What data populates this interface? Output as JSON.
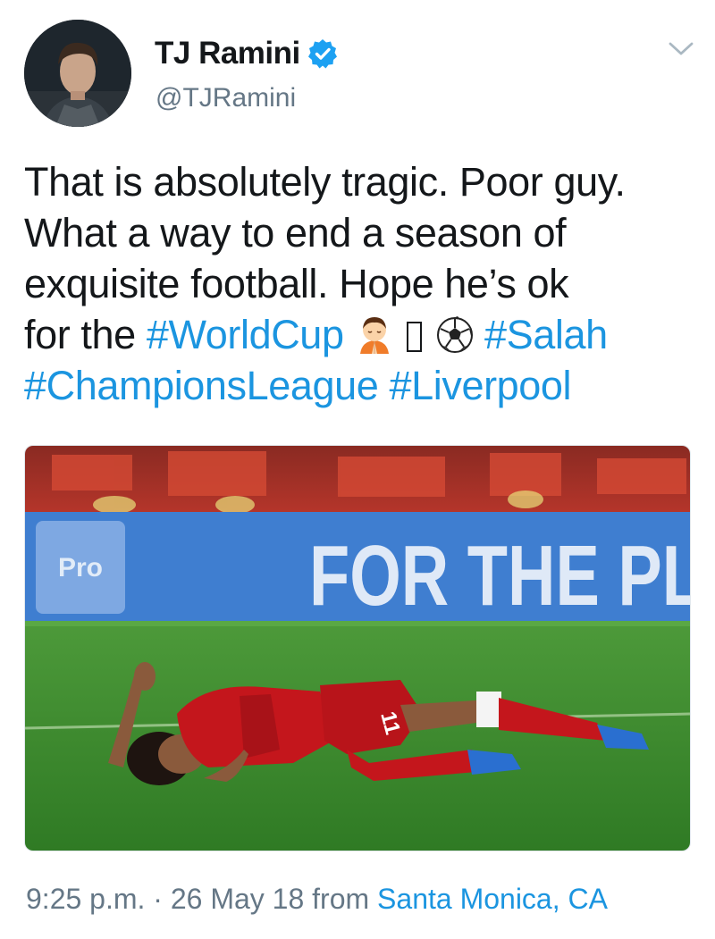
{
  "author": {
    "display_name": "TJ Ramini",
    "handle": "@TJRamini",
    "verified": true,
    "avatar_icon": "profile-avatar",
    "verified_icon": "verified-badge-icon"
  },
  "tweet": {
    "text_line1": "That is absolutely tragic. Poor guy.",
    "text_line2": "What a way to end a season of",
    "text_line3": "exquisite football. Hope he’s ok",
    "text_line4_prefix": "for the ",
    "hashtag_worldcup": "#WorldCup",
    "hashtag_salah": "#Salah",
    "hashtag_champions": "#ChampionsLeague",
    "hashtag_liverpool": "#Liverpool",
    "emojis": [
      "praying-person-emoji",
      "missing-glyph",
      "soccer-ball-emoji"
    ]
  },
  "media": {
    "banner_text": "FOR THE PL",
    "board_logo_text": "Pro",
    "shirt_number": "11"
  },
  "footer": {
    "time": "9:25 p.m.",
    "separator": "·",
    "date": "26 May 18",
    "from_label": "from",
    "location": "Santa Monica, CA"
  },
  "colors": {
    "link": "#1b95e0",
    "text": "#14171a",
    "secondary": "#657786",
    "verified": "#1da1f2",
    "pitch": "#3f8f2e",
    "banner": "#3f7ed0",
    "kit": "#c4161c"
  },
  "menu": {
    "caret_icon": "chevron-down-icon"
  }
}
